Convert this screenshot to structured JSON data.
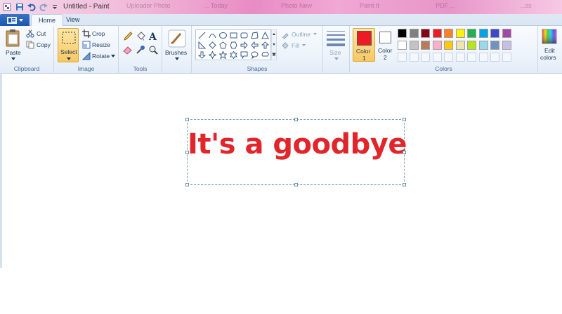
{
  "window": {
    "title": "Untitled - Paint"
  },
  "background_tabs": [
    "Uploader Photo",
    "... Today",
    "Photo New",
    "Paint It",
    "PDF ...",
    "...ss"
  ],
  "tabs": [
    {
      "label": "Home",
      "active": true
    },
    {
      "label": "View",
      "active": false
    }
  ],
  "clipboard": {
    "paste": "Paste",
    "cut": "Cut",
    "copy": "Copy",
    "group": "Clipboard"
  },
  "image": {
    "select": "Select",
    "crop": "Crop",
    "resize": "Resize",
    "rotate": "Rotate",
    "group": "Image"
  },
  "tools": {
    "group": "Tools",
    "items": [
      "pencil",
      "fill",
      "text",
      "eraser",
      "color-picker",
      "magnifier"
    ]
  },
  "brushes": {
    "label": "Brushes"
  },
  "shapes": {
    "outline": "Outline",
    "fill": "Fill",
    "group": "Shapes"
  },
  "size": {
    "label": "Size"
  },
  "colors": {
    "color1_label": "Color",
    "color1_num": "1",
    "color2_label": "Color",
    "color2_num": "2",
    "color1": "#ed1c24",
    "color2": "#ffffff",
    "edit": "Edit",
    "edit2": "colors",
    "group": "Colors",
    "row1": [
      "#000000",
      "#7f7f7f",
      "#880015",
      "#ed1c24",
      "#ff7f27",
      "#fff200",
      "#22b14c",
      "#00a2e8",
      "#3f48cc",
      "#a349a4"
    ],
    "row2": [
      "#ffffff",
      "#c3c3c3",
      "#b97a57",
      "#ffaec9",
      "#ffc90e",
      "#efe4b0",
      "#b5e61d",
      "#99d9ea",
      "#7092be",
      "#c8bfe7"
    ]
  },
  "canvas": {
    "text": "It's a goodbye",
    "text_color": "#e0262b"
  }
}
